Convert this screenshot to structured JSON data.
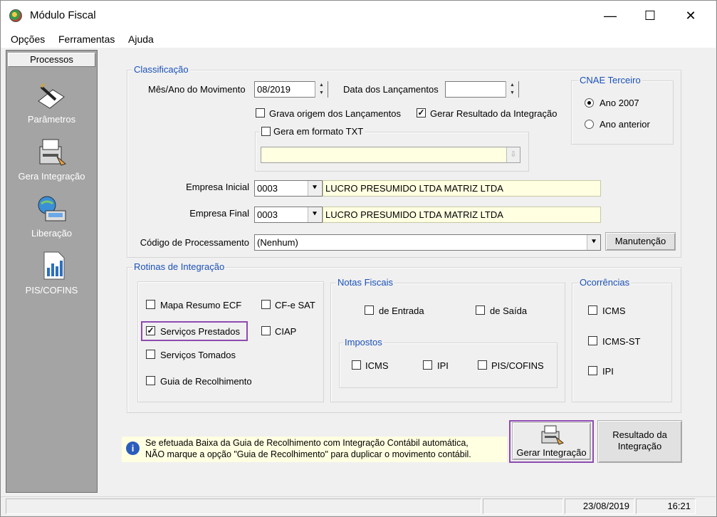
{
  "window": {
    "title": "Módulo Fiscal",
    "minimize": "—",
    "maximize": "☐",
    "close": "✕"
  },
  "menu": {
    "opcoes": "Opções",
    "ferramentas": "Ferramentas",
    "ajuda": "Ajuda"
  },
  "sidebar": {
    "header": "Processos",
    "items": [
      {
        "label": "Parâmetros",
        "icon": "parameters-icon"
      },
      {
        "label": "Gera Integração",
        "icon": "integration-icon"
      },
      {
        "label": "Liberação",
        "icon": "release-icon"
      },
      {
        "label": "PIS/COFINS",
        "icon": "pis-cofins-icon"
      }
    ]
  },
  "classificacao": {
    "legend": "Classificação",
    "mes_ano_label": "Mês/Ano do Movimento",
    "mes_ano_value": "08/2019",
    "data_lanc_label": "Data dos Lançamentos",
    "data_lanc_value": "",
    "grava_origem_label": "Grava origem dos Lançamentos",
    "grava_origem_checked": false,
    "gerar_resultado_label": "Gerar Resultado da Integração",
    "gerar_resultado_checked": true,
    "gera_txt_label": "Gera em formato TXT",
    "gera_txt_checked": false,
    "txt_path_value": "",
    "empresa_inicial_label": "Empresa Inicial",
    "empresa_inicial_code": "0003",
    "empresa_inicial_name": "LUCRO PRESUMIDO LTDA MATRIZ LTDA",
    "empresa_final_label": "Empresa Final",
    "empresa_final_code": "0003",
    "empresa_final_name": "LUCRO PRESUMIDO LTDA MATRIZ LTDA",
    "codigo_proc_label": "Código de Processamento",
    "codigo_proc_value": "(Nenhum)",
    "manutencao_label": "Manutenção"
  },
  "cnae": {
    "legend": "CNAE Terceiro",
    "ano2007_label": "Ano 2007",
    "ano_anterior_label": "Ano anterior",
    "selected": "Ano 2007"
  },
  "rotinas": {
    "legend": "Rotinas de Integração",
    "mapa_resumo_label": "Mapa Resumo ECF",
    "mapa_resumo_checked": false,
    "cfe_sat_label": "CF-e SAT",
    "cfe_sat_checked": false,
    "servicos_prestados_label": "Serviços Prestados",
    "servicos_prestados_checked": true,
    "ciap_label": "CIAP",
    "ciap_checked": false,
    "servicos_tomados_label": "Serviços Tomados",
    "servicos_tomados_checked": false,
    "guia_label": "Guia de Recolhimento",
    "guia_checked": false
  },
  "notas": {
    "legend": "Notas Fiscais",
    "entrada_label": "de Entrada",
    "entrada_checked": false,
    "saida_label": "de Saída",
    "saida_checked": false
  },
  "impostos": {
    "legend": "Impostos",
    "icms_label": "ICMS",
    "icms_checked": false,
    "ipi_label": "IPI",
    "ipi_checked": false,
    "pis_label": "PIS/COFINS",
    "pis_checked": false
  },
  "ocorrencias": {
    "legend": "Ocorrências",
    "icms_label": "ICMS",
    "icms_checked": false,
    "icms_st_label": "ICMS-ST",
    "icms_st_checked": false,
    "ipi_label": "IPI",
    "ipi_checked": false
  },
  "info": {
    "line1": "Se efetuada Baixa da Guia de Recolhimento com Integração Contábil automática,",
    "line2": "NÃO marque a opção \"Guia de Recolhimento\" para duplicar o movimento contábil."
  },
  "buttons": {
    "gerar_integracao": "Gerar Integração",
    "resultado_line1": "Resultado da",
    "resultado_line2": "Integração"
  },
  "status": {
    "date": "23/08/2019",
    "time": "16:21"
  },
  "colors": {
    "highlight": "#8e4bb0",
    "legend": "#1a51b8",
    "sidebar": "#a4a4a4"
  }
}
